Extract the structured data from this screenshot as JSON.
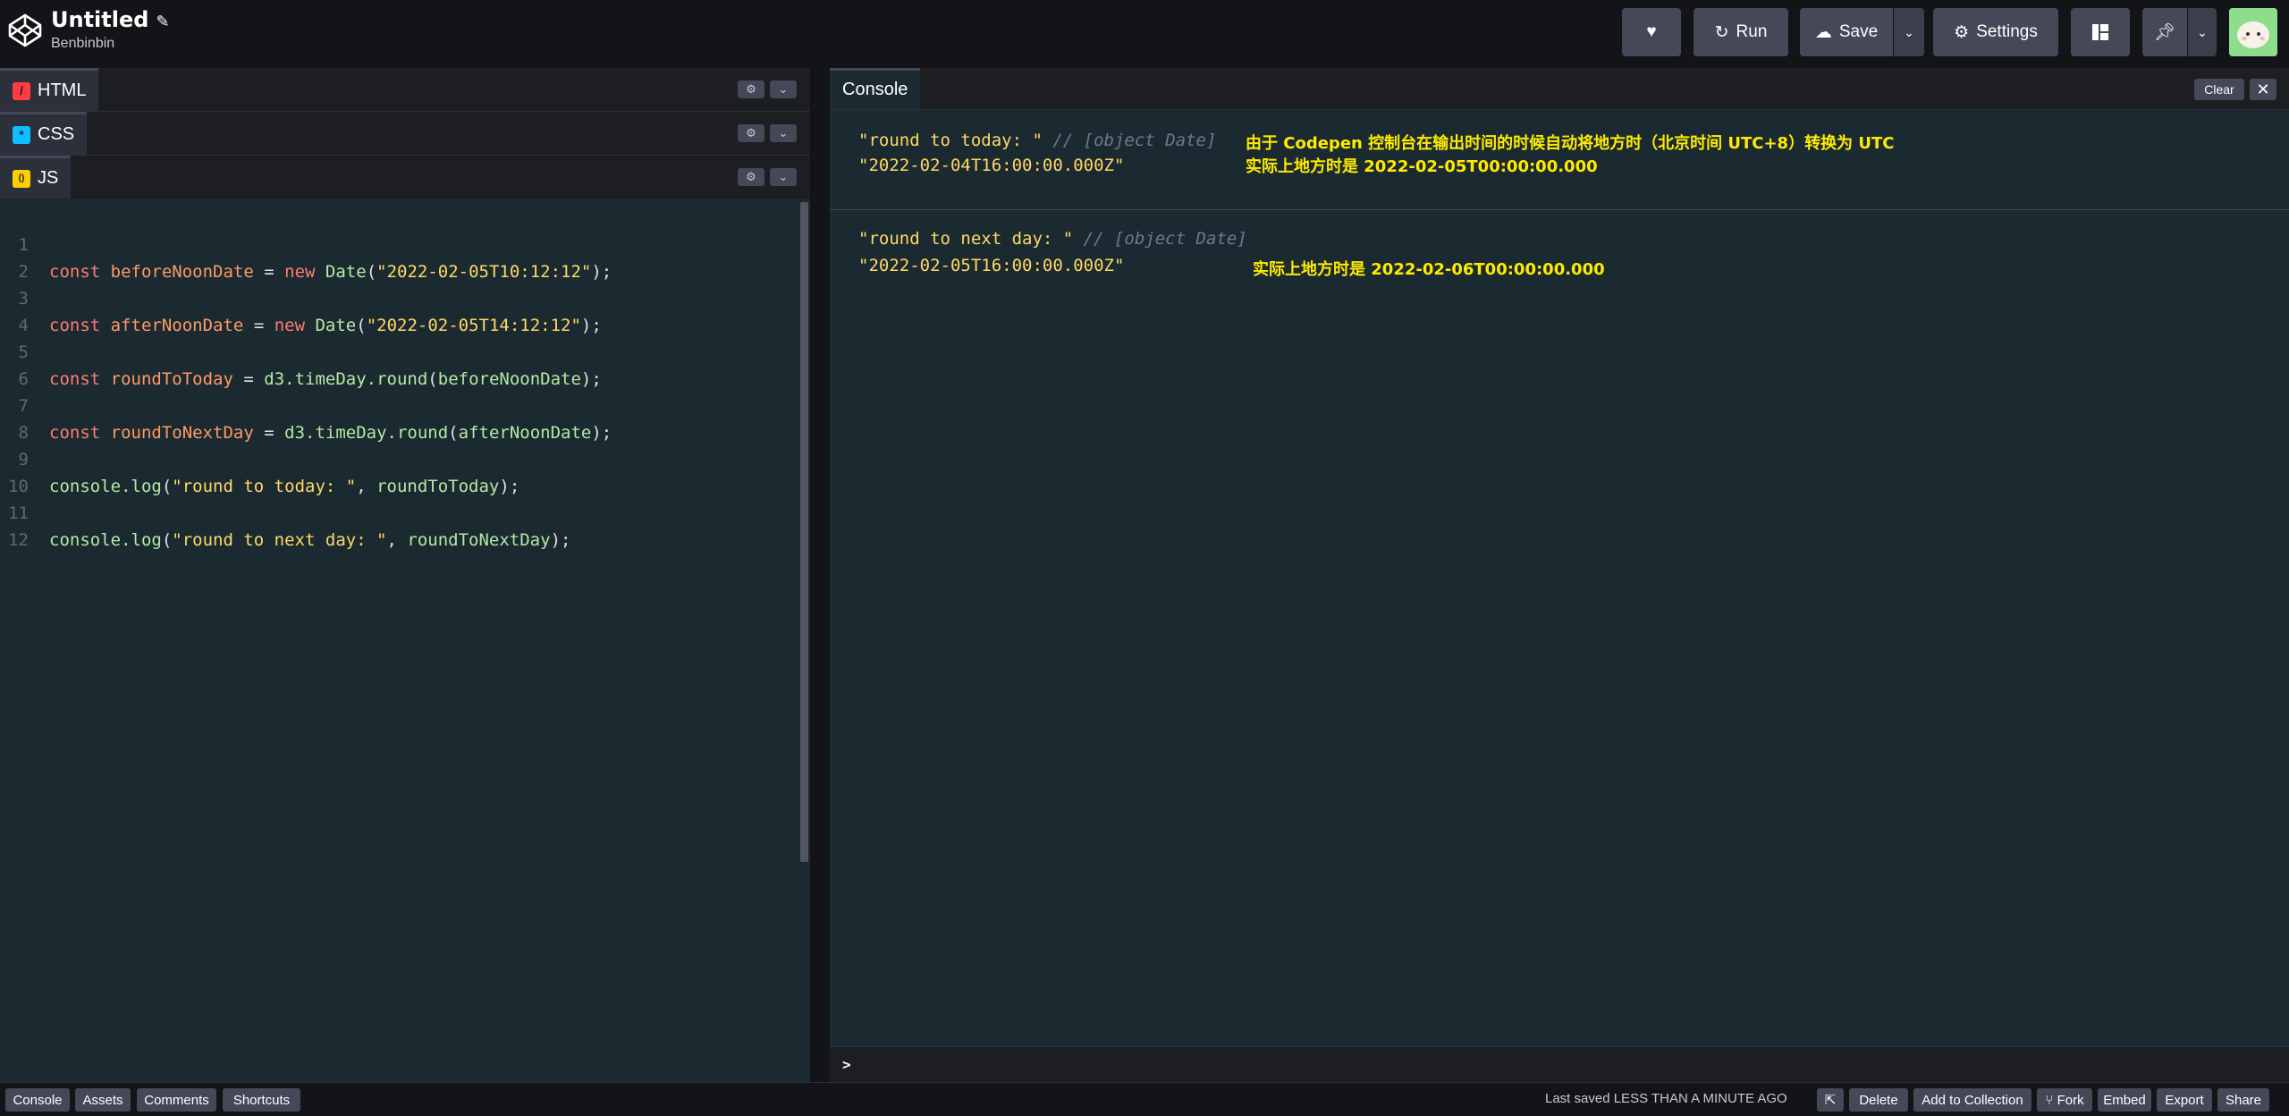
{
  "header": {
    "title": "Untitled",
    "author": "Benbinbin",
    "buttons": {
      "heart_icon": "heart-icon",
      "run_label": "Run",
      "save_label": "Save",
      "settings_label": "Settings"
    }
  },
  "editor": {
    "tabs": [
      {
        "label": "HTML",
        "color": "#ff3c41",
        "glyph": "/"
      },
      {
        "label": "CSS",
        "color": "#0ebeff",
        "glyph": "*"
      },
      {
        "label": "JS",
        "color": "#fcd000",
        "glyph": "()"
      }
    ],
    "line_numbers": [
      "1",
      "2",
      "3",
      "4",
      "5",
      "6",
      "7",
      "8",
      "9",
      "10",
      "11",
      "12"
    ],
    "code": {
      "l1": {
        "kw": "const",
        "var": "beforeNoonDate",
        "eq": " = ",
        "new": "new",
        "fn": "Date",
        "open": "(",
        "str": "\"2022-02-05T10:12:12\"",
        "close": ");"
      },
      "l3": {
        "kw": "const",
        "var": "afterNoonDate",
        "eq": " = ",
        "new": "new",
        "fn": "Date",
        "open": "(",
        "str": "\"2022-02-05T14:12:12\"",
        "close": ");"
      },
      "l5": {
        "kw": "const",
        "var": "roundToToday",
        "eq": " = ",
        "fn": "d3.timeDay.round",
        "open": "(",
        "arg": "beforeNoonDate",
        "close": ");"
      },
      "l7": {
        "kw": "const",
        "var": "roundToNextDay",
        "eq": " = ",
        "fn": "d3.timeDay.round",
        "open": "(",
        "arg": "afterNoonDate",
        "close": ");"
      },
      "l9": {
        "fn": "console.log",
        "open": "(",
        "str": "\"round to today: \"",
        "sep": ", ",
        "arg": "roundToToday",
        "close": ");"
      },
      "l11": {
        "fn": "console.log",
        "open": "(",
        "str": "\"round to next day: \"",
        "sep": ", ",
        "arg": "roundToNextDay",
        "close": ");"
      }
    }
  },
  "console": {
    "tab_label": "Console",
    "clear_label": "Clear",
    "entries": [
      {
        "label": "\"round to today: \"",
        "comment": "// [object Date]",
        "value": "\"2022-02-04T16:00:00.000Z\"",
        "note1": "由于 Codepen 控制台在输出时间的时候自动将地方时（北京时间 UTC+8）转换为 UTC",
        "note2": "实际上地方时是 2022-02-05T00:00:00.000"
      },
      {
        "label": "\"round to next day: \"",
        "comment": "// [object Date]",
        "value": "\"2022-02-05T16:00:00.000Z\"",
        "note1": "实际上地方时是 2022-02-06T00:00:00.000"
      }
    ],
    "prompt": ">"
  },
  "footer": {
    "left_buttons": [
      "Console",
      "Assets",
      "Comments",
      "Shortcuts"
    ],
    "last_saved_prefix": "Last saved",
    "last_saved_value": "LESS THAN A MINUTE AGO",
    "right_buttons": [
      "Delete",
      "Add to Collection",
      "Fork",
      "Embed",
      "Export",
      "Share"
    ]
  },
  "colors": {
    "background": "#131417",
    "button": "#444857",
    "editor_bg": "#1b2a30",
    "annotation": "#ffeb00"
  }
}
